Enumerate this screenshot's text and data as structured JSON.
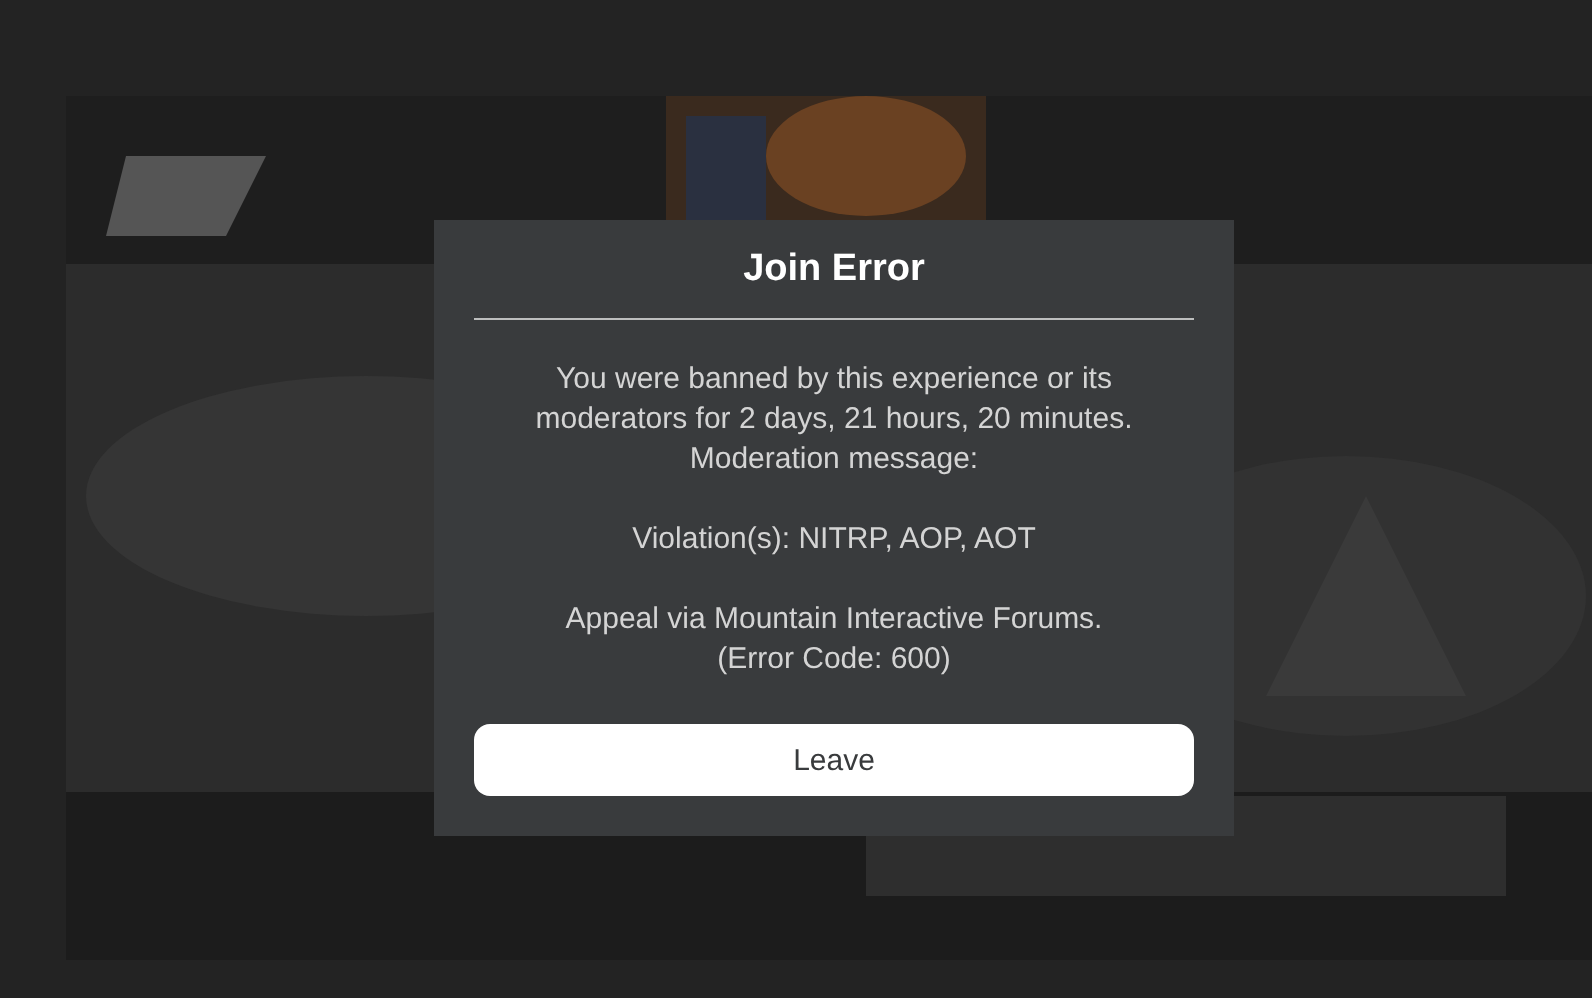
{
  "dialog": {
    "title": "Join Error",
    "paragraphs": [
      [
        "You were banned by this experience or its",
        "moderators for 2 days, 21 hours, 20 minutes.",
        "Moderation message:"
      ],
      [
        "Violation(s): NITRP, AOP, AOT"
      ],
      [
        "Appeal via Mountain Interactive Forums.",
        "(Error Code: 600)"
      ]
    ],
    "buttons": [
      {
        "label": "Leave"
      }
    ]
  }
}
